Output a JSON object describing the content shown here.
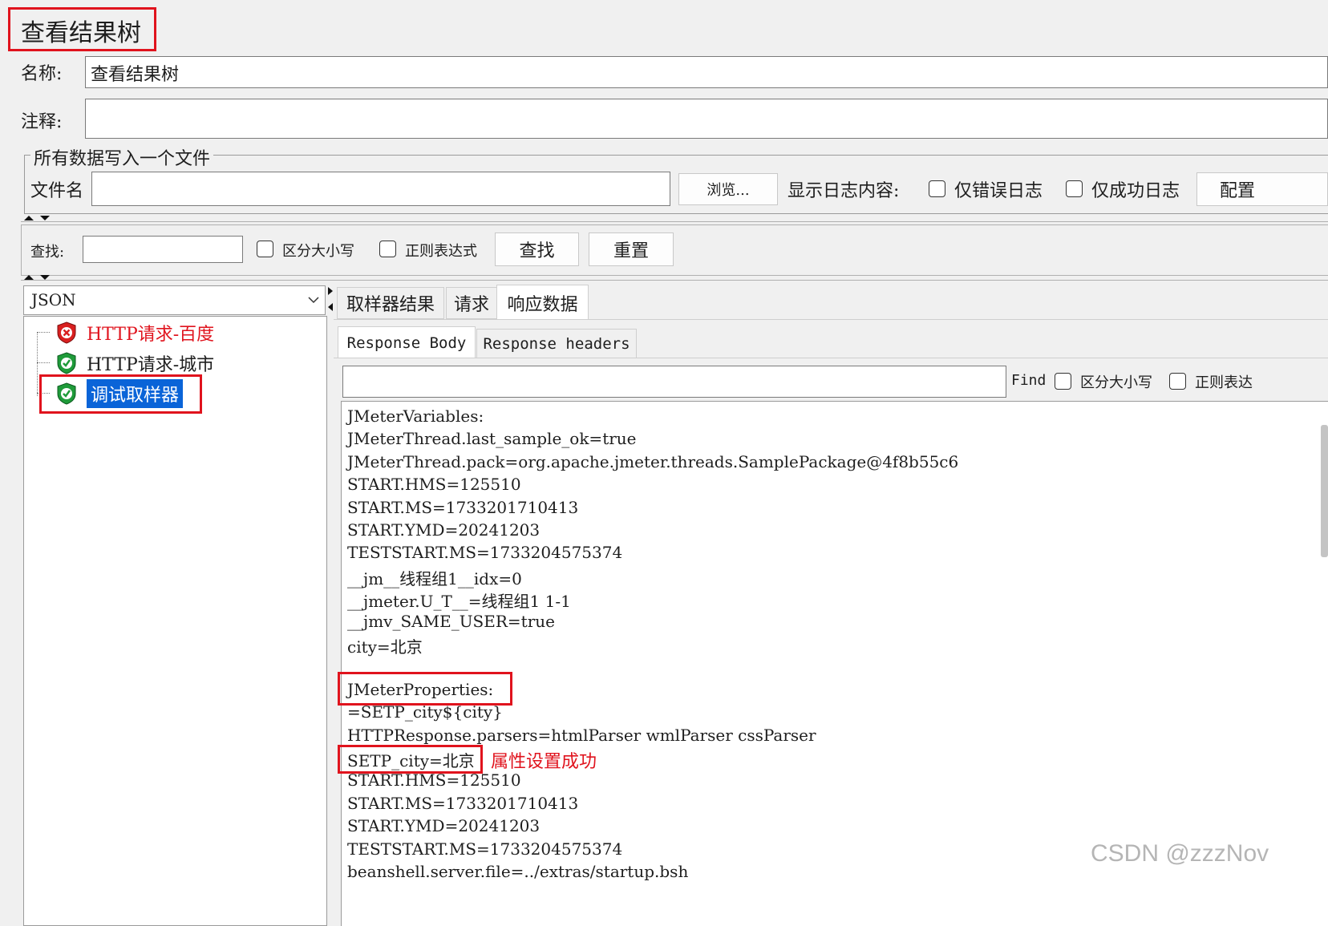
{
  "title": "查看结果树",
  "name_label": "名称:",
  "name_value": "查看结果树",
  "comment_label": "注释:",
  "comment_value": "",
  "file_group": {
    "legend": "所有数据写入一个文件",
    "filename_label": "文件名",
    "filename_value": "",
    "browse_label": "浏览...",
    "log_label": "显示日志内容:",
    "errors_only_label": "仅错误日志",
    "success_only_label": "仅成功日志",
    "configure_label": "配置"
  },
  "search": {
    "label": "查找:",
    "value": "",
    "case_label": "区分大小写",
    "regex_label": "正则表达式",
    "find_button": "查找",
    "reset_button": "重置"
  },
  "renderer": {
    "selected": "JSON"
  },
  "tree": {
    "items": [
      {
        "label": "HTTP请求-百度",
        "status": "error"
      },
      {
        "label": "HTTP请求-城市",
        "status": "ok"
      },
      {
        "label": "调试取样器",
        "status": "ok",
        "selected": true
      }
    ]
  },
  "tabs": [
    "取样器结果",
    "请求",
    "响应数据"
  ],
  "active_tab": "响应数据",
  "subtabs": [
    "Response Body",
    "Response headers"
  ],
  "response_search": {
    "value": "",
    "find_label": "Find",
    "case_label": "区分大小写",
    "regex_label": "正则表达"
  },
  "response_lines": [
    "JMeterVariables:",
    "JMeterThread.last_sample_ok=true",
    "JMeterThread.pack=org.apache.jmeter.threads.SamplePackage@4f8b55c6",
    "START.HMS=125510",
    "START.MS=1733201710413",
    "START.YMD=20241203",
    "TESTSTART.MS=1733204575374",
    "__jm__线程组1__idx=0",
    "__jmeter.U_T__=线程组1 1-1",
    "__jmv_SAME_USER=true",
    "city=北京",
    "",
    "JMeterProperties:",
    "=SETP_city${city}",
    "HTTPResponse.parsers=htmlParser wmlParser cssParser",
    "SETP_city=北京",
    "START.HMS=125510",
    "START.MS=1733201710413",
    "START.YMD=20241203",
    "TESTSTART.MS=1733204575374",
    "beanshell.server.file=../extras/startup.bsh"
  ],
  "annotation": "属性设置成功",
  "watermark": "CSDN @zzzNov",
  "colors": {
    "annotation_red": "#e0131d",
    "selection_blue": "#0a64d8",
    "error_label_red": "#e0131d"
  }
}
